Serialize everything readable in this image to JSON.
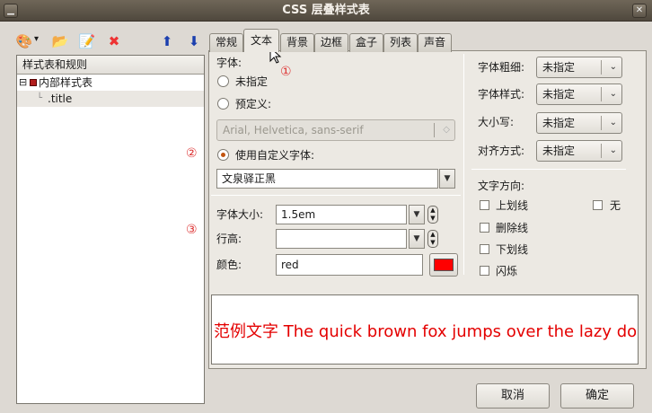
{
  "window": {
    "title": "CSS 层叠样式表",
    "minimize_glyph": "▁",
    "close_glyph": "✕"
  },
  "toolbar": {
    "icons": [
      "palette-dropdown-icon",
      "open-folder-icon",
      "edit-style-icon",
      "delete-icon",
      "move-up-icon",
      "move-down-icon"
    ],
    "palette_glyph": "🎨",
    "folder_glyph": "📂",
    "edit_glyph": "📝",
    "delete_glyph": "✖",
    "up_glyph": "⬆",
    "down_glyph": "⬇",
    "dropdown_glyph": "▾"
  },
  "tree": {
    "header": "样式表和规则",
    "expander": "⊟",
    "root_label": "内部样式表",
    "child_label": ".title"
  },
  "tabs": [
    "常规",
    "文本",
    "背景",
    "边框",
    "盒子",
    "列表",
    "声音"
  ],
  "active_tab": "文本",
  "markers": [
    "①",
    "②",
    "③"
  ],
  "font": {
    "section_label": "字体:",
    "unspecified_label": "未指定",
    "predefined_label": "预定义:",
    "predefined_value": "Arial, Helvetica, sans-serif",
    "custom_label": "使用自定义字体:",
    "custom_value": "文泉驿正黑",
    "selected": "custom"
  },
  "size": {
    "label": "字体大小:",
    "value": "1.5em"
  },
  "line_height": {
    "label": "行高:",
    "value": ""
  },
  "color": {
    "label": "颜色:",
    "value": "red",
    "swatch": "#ff0000"
  },
  "right": {
    "weight_label": "字体粗细:",
    "weight_value": "未指定",
    "style_label": "字体样式:",
    "style_value": "未指定",
    "case_label": "大小写:",
    "case_value": "未指定",
    "align_label": "对齐方式:",
    "align_value": "未指定",
    "decoration_label": "文字方向:",
    "underline": "上划线",
    "none": "无",
    "strike": "删除线",
    "overline": "下划线",
    "blink": "闪烁"
  },
  "preview": {
    "sample_cn": "范例文字",
    "sample_en": " The quick brown fox jumps over the lazy dog"
  },
  "buttons": {
    "cancel": "取消",
    "ok": "确定"
  },
  "colors": {
    "accent": "#c2540f",
    "marker": "#dd3333",
    "preview_text": "#e40000"
  }
}
